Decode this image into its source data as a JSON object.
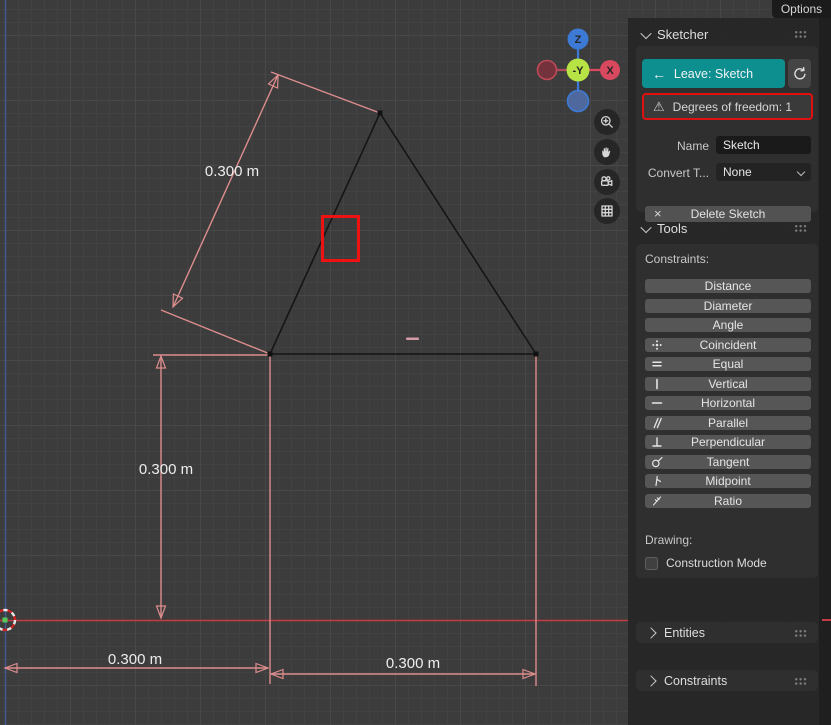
{
  "options_tab": "Options",
  "viewport": {
    "gizmo": {
      "z_label": "Z",
      "x_label": "X",
      "center_label": "-Y"
    },
    "nav_buttons": [
      "zoom-in",
      "pan-hand",
      "camera-view",
      "grid-toggle"
    ],
    "dim_diagonal": "0.300 m",
    "dim_vertical": "0.300 m",
    "dim_bottom_left": "0.300 m",
    "dim_bottom_right": "0.300 m"
  },
  "panel": {
    "title": "Sketcher",
    "leave_button": "Leave: Sketch",
    "dof_warning": "Degrees of freedom: 1",
    "name_label": "Name",
    "name_value": "Sketch",
    "convert_label": "Convert T...",
    "convert_value": "None",
    "delete_button": "Delete Sketch",
    "tools_title": "Tools",
    "constraints_label": "Constraints:",
    "constraint_buttons": [
      {
        "label": "Distance",
        "icon": ""
      },
      {
        "label": "Diameter",
        "icon": ""
      },
      {
        "label": "Angle",
        "icon": ""
      },
      {
        "label": "Coincident",
        "icon": "coincident-icon"
      },
      {
        "label": "Equal",
        "icon": "equal-icon"
      },
      {
        "label": "Vertical",
        "icon": "vertical-icon"
      },
      {
        "label": "Horizontal",
        "icon": "horizontal-icon"
      },
      {
        "label": "Parallel",
        "icon": "parallel-icon"
      },
      {
        "label": "Perpendicular",
        "icon": "perpendicular-icon"
      },
      {
        "label": "Tangent",
        "icon": "tangent-icon"
      },
      {
        "label": "Midpoint",
        "icon": "midpoint-icon"
      },
      {
        "label": "Ratio",
        "icon": "ratio-icon"
      }
    ],
    "drawing_label": "Drawing:",
    "construction_mode_label": "Construction Mode",
    "construction_mode_checked": false,
    "entities_title": "Entities",
    "constraints_title": "Constraints"
  },
  "colors": {
    "accent_teal": "#0d8f90",
    "warning_red": "#e01010",
    "dimension_pink": "#dd8d8d",
    "axis_x_red": "#c23c45",
    "axis_z_blue": "#41598f",
    "selection_red": "#ee1212",
    "sketch_line": "#151515"
  }
}
